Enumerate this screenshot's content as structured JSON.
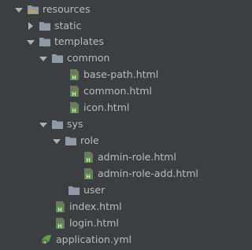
{
  "tree": {
    "resources": "resources",
    "static": "static",
    "templates": "templates",
    "common": "common",
    "base_path": "base-path.html",
    "common_html": "common.html",
    "icon_html": "icon.html",
    "sys": "sys",
    "role": "role",
    "admin_role": "admin-role.html",
    "admin_role_add": "admin-role-add.html",
    "user": "user",
    "index": "index.html",
    "login": "login.html",
    "application": "application.yml"
  },
  "colors": {
    "background": "#3c3f41",
    "text": "#bbbbbb",
    "folder": "#8f9aa6",
    "html_icon": "#5f9d4a",
    "yml_icon": "#5f9d4a"
  }
}
